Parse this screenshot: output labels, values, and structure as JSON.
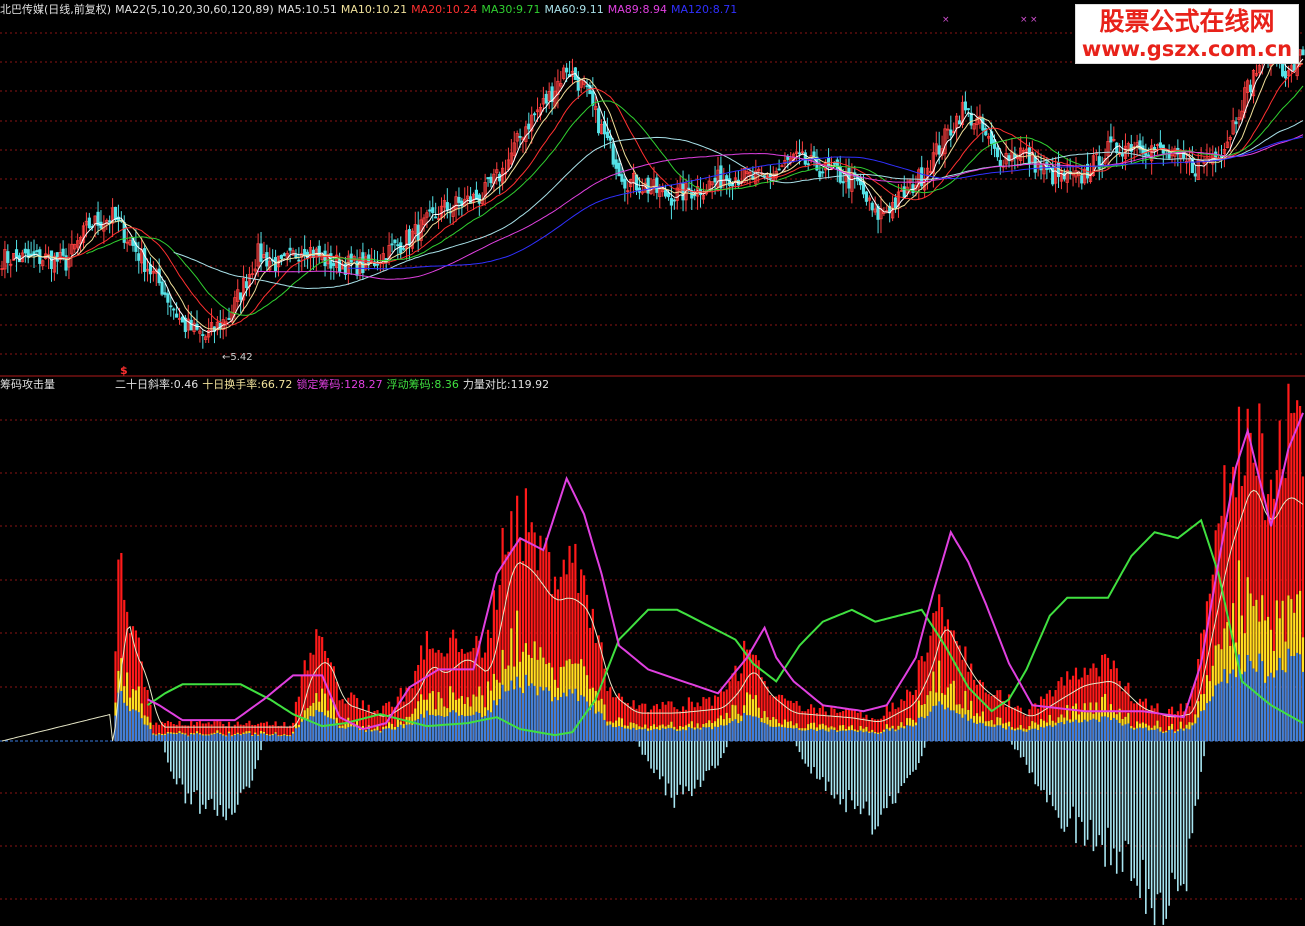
{
  "colors": {
    "background": "#000000",
    "up_candle": "#ff4040",
    "down_candle": "#54e3e8",
    "grid": "#8a1515",
    "separator": "#b01a1a",
    "ma5": "#ffffff",
    "ma10": "#f0e09a",
    "ma20": "#ff3030",
    "ma30": "#30d030",
    "ma60": "#a8e0e8",
    "ma89": "#e040e0",
    "ma120": "#3030ff",
    "red_bar": "#ff1a1a",
    "yellow_bar": "#ffe020",
    "blue_bar": "#3a7de0",
    "cyan_bar": "#a8e6f2",
    "magenta_line": "#e040e0",
    "green_line": "#40e040",
    "white_line": "#e8e8c8"
  },
  "top_header": {
    "title": "北巴传媒(日线,前复权)",
    "ma_params": "MA22(5,10,20,30,60,120,89)",
    "ma5_label": "MA5:",
    "ma5_value": "10.51",
    "ma10_label": "MA10:",
    "ma10_value": "10.21",
    "ma20_label": "MA20:",
    "ma20_value": "10.24",
    "ma30_label": "MA30:",
    "ma30_value": "9.71",
    "ma60_label": "MA60:",
    "ma60_value": "9.11",
    "ma89_label": "MA89:",
    "ma89_value": "8.94",
    "ma120_label": "MA120:",
    "ma120_value": "8.71"
  },
  "bottom_header": {
    "name": "筹码攻击量",
    "slope_label": "二十日斜率:",
    "slope_value": "0.46",
    "turnover_label": "十日换手率:",
    "turnover_value": "66.72",
    "locked_label": "锁定筹码:",
    "locked_value": "128.27",
    "floating_label": "浮动筹码:",
    "floating_value": "8.36",
    "power_label": "力量对比:",
    "power_value": "119.92"
  },
  "annotations": {
    "low_price": "5.42",
    "signal_mark": "$",
    "x_marks": [
      "×",
      "×",
      "×"
    ]
  },
  "watermark": {
    "title": "股票公式在线网",
    "url": "www.gszx.com.cn"
  },
  "chart_data": [
    {
      "type": "candlestick",
      "title": "北巴传媒(日线,前复权)",
      "ylim": [
        5.0,
        13.5
      ],
      "anchors": [
        [
          0,
          7.7
        ],
        [
          15,
          7.7
        ],
        [
          22,
          7.6
        ],
        [
          30,
          8.5
        ],
        [
          38,
          8.7
        ],
        [
          46,
          7.9
        ],
        [
          55,
          7.0
        ],
        [
          62,
          6.1
        ],
        [
          70,
          5.8
        ],
        [
          78,
          6.3
        ],
        [
          88,
          7.8
        ],
        [
          96,
          7.5
        ],
        [
          104,
          8.0
        ],
        [
          112,
          7.6
        ],
        [
          125,
          7.5
        ],
        [
          140,
          8.2
        ],
        [
          152,
          8.9
        ],
        [
          165,
          9.2
        ],
        [
          172,
          9.8
        ],
        [
          180,
          10.9
        ],
        [
          188,
          11.6
        ],
        [
          194,
          12.3
        ],
        [
          200,
          11.8
        ],
        [
          206,
          10.8
        ],
        [
          214,
          9.6
        ],
        [
          222,
          9.4
        ],
        [
          230,
          9.2
        ],
        [
          240,
          9.4
        ],
        [
          250,
          9.7
        ],
        [
          262,
          9.6
        ],
        [
          272,
          10.1
        ],
        [
          284,
          9.8
        ],
        [
          294,
          9.5
        ],
        [
          300,
          8.7
        ],
        [
          308,
          9.1
        ],
        [
          316,
          9.7
        ],
        [
          324,
          10.6
        ],
        [
          330,
          11.3
        ],
        [
          336,
          10.9
        ],
        [
          342,
          10.1
        ],
        [
          350,
          10.3
        ],
        [
          360,
          9.7
        ],
        [
          370,
          9.6
        ],
        [
          380,
          10.3
        ],
        [
          390,
          10.5
        ],
        [
          400,
          10.2
        ],
        [
          410,
          9.9
        ],
        [
          420,
          10.4
        ],
        [
          426,
          11.5
        ],
        [
          432,
          12.4
        ],
        [
          436,
          12.8
        ],
        [
          442,
          12.1
        ],
        [
          447,
          12.7
        ]
      ],
      "low_label_value": 5.42,
      "moving_averages": [
        "MA5",
        "MA10",
        "MA20",
        "MA30",
        "MA60",
        "MA89",
        "MA120"
      ]
    },
    {
      "type": "bar",
      "title": "筹码攻击量",
      "ylim": [
        -3.0,
        5.8
      ],
      "series": [
        {
          "name": "锁定筹码"
        },
        {
          "name": "浮动筹码"
        }
      ],
      "attack_anchors": [
        [
          0,
          0
        ],
        [
          38,
          0
        ],
        [
          40,
          3.2
        ],
        [
          43,
          2.0
        ],
        [
          48,
          1.4
        ],
        [
          52,
          0.3
        ],
        [
          100,
          0.3
        ],
        [
          104,
          1.4
        ],
        [
          110,
          1.8
        ],
        [
          116,
          0.8
        ],
        [
          130,
          0.5
        ],
        [
          140,
          0.9
        ],
        [
          146,
          1.7
        ],
        [
          150,
          1.4
        ],
        [
          158,
          1.8
        ],
        [
          166,
          1.4
        ],
        [
          174,
          3.9
        ],
        [
          180,
          3.7
        ],
        [
          188,
          3.0
        ],
        [
          194,
          3.1
        ],
        [
          200,
          2.8
        ],
        [
          208,
          1.0
        ],
        [
          216,
          0.6
        ],
        [
          230,
          0.6
        ],
        [
          246,
          0.7
        ],
        [
          252,
          1.1
        ],
        [
          256,
          1.6
        ],
        [
          262,
          1.0
        ],
        [
          270,
          0.6
        ],
        [
          290,
          0.5
        ],
        [
          300,
          0.4
        ],
        [
          312,
          0.8
        ],
        [
          318,
          1.6
        ],
        [
          322,
          2.6
        ],
        [
          328,
          1.8
        ],
        [
          334,
          1.2
        ],
        [
          342,
          0.8
        ],
        [
          352,
          0.5
        ],
        [
          362,
          0.9
        ],
        [
          370,
          1.2
        ],
        [
          380,
          1.3
        ],
        [
          390,
          0.7
        ],
        [
          400,
          0.5
        ],
        [
          408,
          0.6
        ],
        [
          414,
          2.3
        ],
        [
          420,
          4.1
        ],
        [
          428,
          5.6
        ],
        [
          434,
          4.6
        ],
        [
          440,
          5.3
        ],
        [
          447,
          5.0
        ]
      ],
      "magenta_anchors": [
        [
          50,
          0.7
        ],
        [
          54,
          0.6
        ],
        [
          62,
          0.35
        ],
        [
          80,
          0.35
        ],
        [
          90,
          0.7
        ],
        [
          100,
          1.1
        ],
        [
          110,
          1.1
        ],
        [
          116,
          0.4
        ],
        [
          124,
          0.2
        ],
        [
          132,
          0.3
        ],
        [
          140,
          0.9
        ],
        [
          150,
          1.2
        ],
        [
          162,
          1.2
        ],
        [
          170,
          2.8
        ],
        [
          178,
          3.4
        ],
        [
          186,
          3.2
        ],
        [
          194,
          4.4
        ],
        [
          200,
          3.8
        ],
        [
          206,
          2.8
        ],
        [
          212,
          1.6
        ],
        [
          222,
          1.2
        ],
        [
          234,
          1.0
        ],
        [
          246,
          0.8
        ],
        [
          256,
          1.4
        ],
        [
          262,
          1.9
        ],
        [
          266,
          1.4
        ],
        [
          272,
          1.0
        ],
        [
          282,
          0.6
        ],
        [
          296,
          0.5
        ],
        [
          304,
          0.6
        ],
        [
          314,
          1.4
        ],
        [
          320,
          2.5
        ],
        [
          326,
          3.5
        ],
        [
          332,
          3.0
        ],
        [
          338,
          2.3
        ],
        [
          346,
          1.3
        ],
        [
          354,
          0.6
        ],
        [
          372,
          0.5
        ],
        [
          392,
          0.5
        ],
        [
          406,
          0.4
        ],
        [
          412,
          1.3
        ],
        [
          418,
          3.0
        ],
        [
          424,
          4.6
        ],
        [
          428,
          5.2
        ],
        [
          436,
          3.6
        ],
        [
          442,
          4.9
        ],
        [
          447,
          5.5
        ]
      ],
      "green_anchors": [
        [
          50,
          0.6
        ],
        [
          56,
          0.8
        ],
        [
          62,
          0.95
        ],
        [
          70,
          0.95
        ],
        [
          82,
          0.95
        ],
        [
          92,
          0.7
        ],
        [
          100,
          0.45
        ],
        [
          110,
          0.25
        ],
        [
          118,
          0.3
        ],
        [
          130,
          0.45
        ],
        [
          146,
          0.25
        ],
        [
          160,
          0.3
        ],
        [
          170,
          0.4
        ],
        [
          178,
          0.2
        ],
        [
          190,
          0.1
        ],
        [
          196,
          0.15
        ],
        [
          204,
          0.7
        ],
        [
          212,
          1.7
        ],
        [
          222,
          2.2
        ],
        [
          232,
          2.2
        ],
        [
          244,
          1.9
        ],
        [
          252,
          1.7
        ],
        [
          258,
          1.3
        ],
        [
          266,
          1.0
        ],
        [
          274,
          1.6
        ],
        [
          282,
          2.0
        ],
        [
          292,
          2.2
        ],
        [
          300,
          2.0
        ],
        [
          308,
          2.1
        ],
        [
          316,
          2.2
        ],
        [
          324,
          1.6
        ],
        [
          332,
          0.9
        ],
        [
          340,
          0.5
        ],
        [
          346,
          0.7
        ],
        [
          352,
          1.2
        ],
        [
          360,
          2.1
        ],
        [
          366,
          2.4
        ],
        [
          374,
          2.4
        ],
        [
          380,
          2.4
        ],
        [
          388,
          3.1
        ],
        [
          396,
          3.5
        ],
        [
          404,
          3.4
        ],
        [
          412,
          3.7
        ],
        [
          418,
          2.8
        ],
        [
          426,
          1.0
        ],
        [
          436,
          0.6
        ],
        [
          447,
          0.3
        ]
      ],
      "negative_anchors": [
        [
          55,
          0
        ],
        [
          58,
          -0.5
        ],
        [
          62,
          -0.9
        ],
        [
          70,
          -1.2
        ],
        [
          80,
          -1.2
        ],
        [
          86,
          -0.6
        ],
        [
          90,
          0
        ],
        [
          218,
          0
        ],
        [
          222,
          -0.4
        ],
        [
          230,
          -1.0
        ],
        [
          238,
          -0.8
        ],
        [
          246,
          -0.4
        ],
        [
          250,
          0
        ],
        [
          272,
          0
        ],
        [
          276,
          -0.4
        ],
        [
          284,
          -0.8
        ],
        [
          294,
          -1.2
        ],
        [
          300,
          -1.5
        ],
        [
          306,
          -1.0
        ],
        [
          314,
          -0.5
        ],
        [
          318,
          0
        ],
        [
          346,
          0
        ],
        [
          352,
          -0.4
        ],
        [
          358,
          -1.0
        ],
        [
          366,
          -1.4
        ],
        [
          378,
          -1.8
        ],
        [
          390,
          -2.4
        ],
        [
          400,
          -2.9
        ],
        [
          406,
          -2.7
        ],
        [
          412,
          -0.5
        ],
        [
          414,
          0
        ]
      ]
    }
  ]
}
